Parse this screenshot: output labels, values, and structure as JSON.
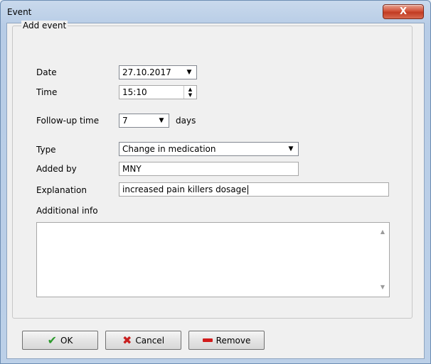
{
  "window": {
    "title": "Event",
    "close_glyph": "X"
  },
  "group": {
    "legend": "Add event"
  },
  "form": {
    "date": {
      "label": "Date",
      "value": "27.10.2017"
    },
    "time": {
      "label": "Time",
      "value": "15:10"
    },
    "followup": {
      "label": "Follow-up time",
      "value": "7",
      "unit": "days"
    },
    "type": {
      "label": "Type",
      "value": "Change in medication"
    },
    "added_by": {
      "label": "Added by",
      "value": "MNY"
    },
    "explanation": {
      "label": "Explanation",
      "value": "increased pain killers dosage"
    },
    "additional_info": {
      "label": "Additional info",
      "value": ""
    }
  },
  "buttons": {
    "ok": "OK",
    "cancel": "Cancel",
    "remove": "Remove"
  },
  "icons": {
    "close": "close-icon",
    "ok": "checkmark-icon",
    "cancel": "x-icon",
    "remove": "minus-icon",
    "dropdown": "chevron-down-icon",
    "spin": "spin-arrows-icon"
  },
  "colors": {
    "ok_icon": "#2c9a2c",
    "cancel_icon": "#c81f1f",
    "remove_icon": "#d11b1b",
    "close_button": "#c94a34"
  }
}
